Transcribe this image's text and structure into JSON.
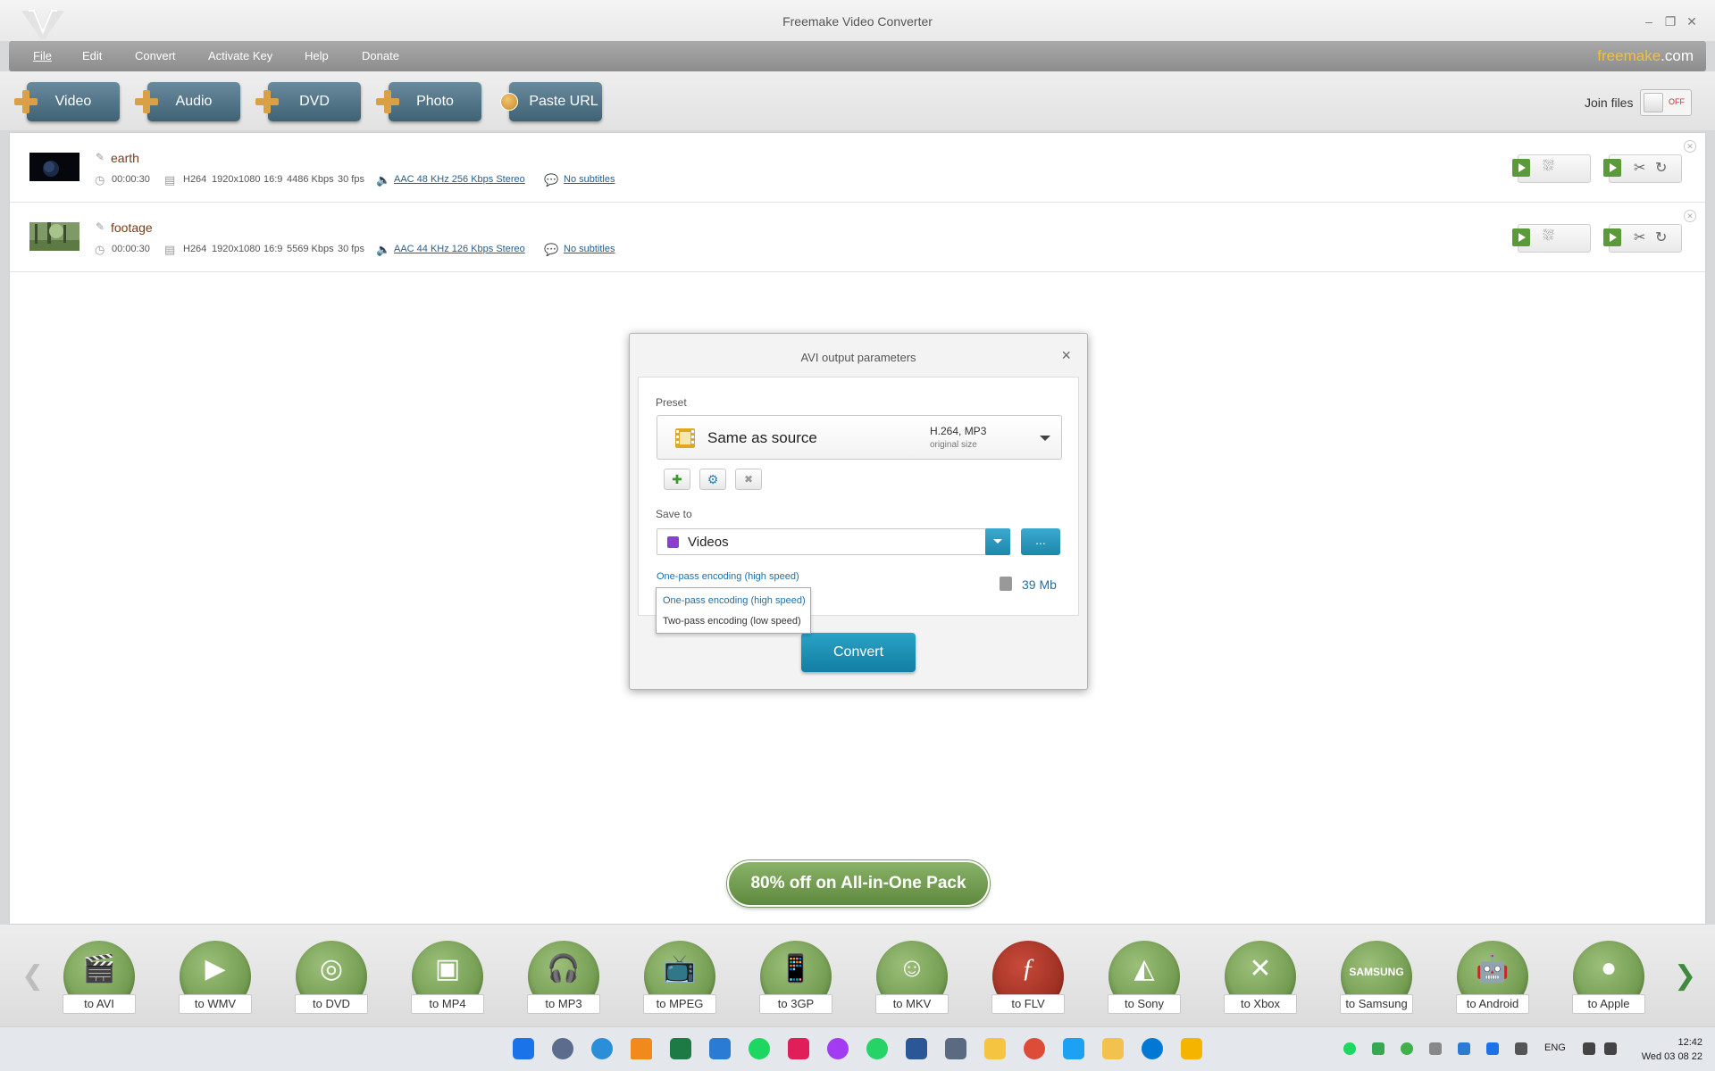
{
  "window": {
    "title": "Freemake Video Converter"
  },
  "menu": {
    "items": [
      "File",
      "Edit",
      "Convert",
      "Activate Key",
      "Help",
      "Donate"
    ],
    "brand_main": "freemake",
    "brand_suffix": ".com"
  },
  "toolbar": {
    "buttons": [
      "Video",
      "Audio",
      "DVD",
      "Photo",
      "Paste URL"
    ],
    "join_label": "Join files",
    "join_state": "OFF"
  },
  "files": [
    {
      "name": "earth",
      "duration": "00:00:30",
      "codec": "H264",
      "resolution": "1920x1080",
      "aspect": "16:9",
      "bitrate": "4486 Kbps",
      "fps": "30 fps",
      "audio": "AAC  48 KHz  256 Kbps  Stereo",
      "subtitles": "No subtitles"
    },
    {
      "name": "footage",
      "duration": "00:00:30",
      "codec": "H264",
      "resolution": "1920x1080",
      "aspect": "16:9",
      "bitrate": "5569 Kbps",
      "fps": "30 fps",
      "audio": "AAC  44 KHz  126 Kbps  Stereo",
      "subtitles": "No subtitles"
    }
  ],
  "dialog": {
    "title": "AVI output parameters",
    "close": "×",
    "preset_label": "Preset",
    "preset_name": "Same as source",
    "preset_codec": "H.264, MP3",
    "preset_size": "original size",
    "save_label": "Save to",
    "save_value": "Videos",
    "browse": "...",
    "encoding": "One-pass encoding (high speed)",
    "size": "39 Mb",
    "convert": "Convert"
  },
  "encoding_menu": {
    "options": [
      "One-pass encoding (high speed)",
      "Two-pass encoding (low speed)"
    ]
  },
  "promo": "80% off on All-in-One Pack",
  "formats": [
    "to AVI",
    "to WMV",
    "to DVD",
    "to MP4",
    "to MP3",
    "to MPEG",
    "to 3GP",
    "to MKV",
    "to FLV",
    "to Sony",
    "to Xbox",
    "to Samsung",
    "to Android",
    "to Apple"
  ],
  "format_glyphs": {
    "samsung": "SAMSUNG"
  },
  "taskbar": {
    "lang": "ENG",
    "time": "12:42",
    "date": "Wed 03 08 22"
  },
  "colors": {
    "accent": "#1e87ab",
    "format_green": "#6f9a4a",
    "toolbar_button": "#4e7285"
  }
}
